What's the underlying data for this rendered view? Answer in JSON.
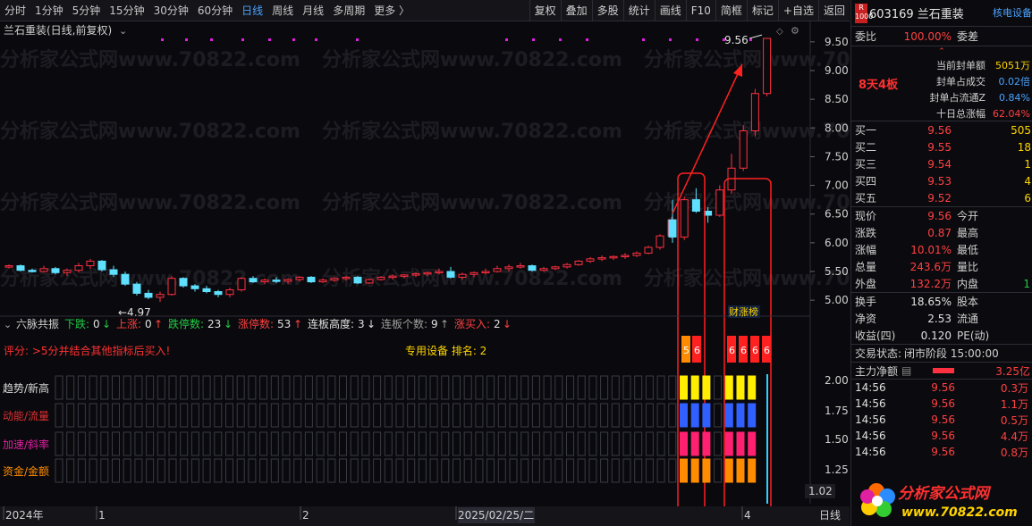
{
  "toolbar": {
    "periods": [
      "分时",
      "1分钟",
      "5分钟",
      "15分钟",
      "30分钟",
      "60分钟",
      "日线",
      "周线",
      "月线",
      "多周期",
      "更多 〉"
    ],
    "active": "日线",
    "buttons": [
      "复权",
      "叠加",
      "多股",
      "统计",
      "画线",
      "F10",
      "简框",
      "标记",
      "+自选",
      "返回"
    ]
  },
  "chart": {
    "title": "兰石重装(日线,前复权)",
    "price_ticks": [
      "9.50",
      "9.00",
      "8.50",
      "8.00",
      "7.50",
      "7.00",
      "6.50",
      "6.00",
      "5.50",
      "5.00"
    ],
    "high_label": "9.56",
    "low_label": "←4.97",
    "watermark": "分析家公式网www.70822.com"
  },
  "indicator": {
    "name": "六脉共振",
    "stats": [
      {
        "label": "下跌:",
        "value": "0",
        "color": "#22cc44"
      },
      {
        "label": "上涨:",
        "value": "0",
        "color": "#ff4040"
      },
      {
        "label": "跌停数:",
        "value": "23",
        "color": "#22cc44"
      },
      {
        "label": "涨停数:",
        "value": "53",
        "color": "#ff4040"
      },
      {
        "label": "连板高度:",
        "value": "3",
        "color": "#e0e0e0"
      },
      {
        "label": "连板个数:",
        "value": "9",
        "color": "#a0a0a0"
      },
      {
        "label": "涨买入:",
        "value": "2",
        "color": "#ff4040"
      }
    ],
    "score_text": "评分: >5分并结合其他指标后买入!",
    "special_text": "专用设备 排名: 2",
    "rows": [
      "趋势/新高",
      "动能/流量",
      "加速/斜率",
      "资金/金额"
    ],
    "ticks": [
      "2.00",
      "1.75",
      "1.50",
      "1.25"
    ],
    "current_value": "1.02",
    "badge": "财涨榜",
    "markers": [
      "5",
      "6",
      "6",
      "6",
      "6",
      "6"
    ]
  },
  "timeline": {
    "labels": [
      "2024年",
      "1",
      "2",
      "2025/02/25/二",
      "4"
    ],
    "period": "日线"
  },
  "panel": {
    "badge": "R",
    "badge_sub": "1000",
    "code": "603169 兰石重装",
    "tag": "核电设备",
    "weibi_label": "委比",
    "weibi_value": "100.00%",
    "weicha_label": "委差",
    "limit_tag": "8天4板",
    "stats": [
      {
        "label": "当前封单额",
        "value": "5051万"
      },
      {
        "label": "封单占成交",
        "value": "0.02倍"
      },
      {
        "label": "封单占流通Z",
        "value": "0.84%"
      },
      {
        "label": "十日总涨幅",
        "value": "62.04%"
      }
    ],
    "bids": [
      {
        "label": "买一",
        "price": "9.56",
        "vol": "505"
      },
      {
        "label": "买二",
        "price": "9.55",
        "vol": "18"
      },
      {
        "label": "买三",
        "price": "9.54",
        "vol": "1"
      },
      {
        "label": "买四",
        "price": "9.53",
        "vol": "4"
      },
      {
        "label": "买五",
        "price": "9.52",
        "vol": "6"
      }
    ],
    "quote": [
      {
        "l1": "现价",
        "v1": "9.56",
        "l2": "今开",
        "v2": ""
      },
      {
        "l1": "涨跌",
        "v1": "0.87",
        "l2": "最高",
        "v2": ""
      },
      {
        "l1": "涨幅",
        "v1": "10.01%",
        "l2": "最低",
        "v2": ""
      },
      {
        "l1": "总量",
        "v1": "243.6万",
        "l2": "量比",
        "v2": ""
      },
      {
        "l1": "外盘",
        "v1": "132.2万",
        "l2": "内盘",
        "v2": "1"
      }
    ],
    "info": [
      {
        "l": "换手",
        "v": "18.65%",
        "l2": "股本"
      },
      {
        "l": "净资",
        "v": "2.53",
        "l2": "流通"
      },
      {
        "l": "收益(四)",
        "v": "0.120",
        "l2": "PE(动)"
      }
    ],
    "status_label": "交易状态:",
    "status_value": "闭市阶段 15:00:00",
    "fund_label": "主力净额",
    "fund_value": "3.25亿",
    "ticks": [
      {
        "t": "14:56",
        "p": "9.56",
        "v": "0.3万"
      },
      {
        "t": "14:56",
        "p": "9.56",
        "v": "1.1万"
      },
      {
        "t": "14:56",
        "p": "9.56",
        "v": "0.5万"
      },
      {
        "t": "14:56",
        "p": "9.56",
        "v": "4.4万"
      },
      {
        "t": "14:56",
        "p": "9.56",
        "v": "0.8万"
      }
    ]
  },
  "logo": {
    "title": "分析家公式网",
    "url": "www.70822.com"
  },
  "chart_data": {
    "type": "candlestick",
    "title": "兰石重装(日线,前复权)",
    "ylim": [
      4.8,
      9.7
    ],
    "y_ticks": [
      5.0,
      5.5,
      6.0,
      6.5,
      7.0,
      7.5,
      8.0,
      8.5,
      9.0,
      9.5
    ],
    "candles": [
      [
        5.58,
        5.62,
        5.55,
        5.6
      ],
      [
        5.6,
        5.62,
        5.5,
        5.52
      ],
      [
        5.52,
        5.55,
        5.48,
        5.5
      ],
      [
        5.5,
        5.6,
        5.48,
        5.55
      ],
      [
        5.55,
        5.58,
        5.45,
        5.48
      ],
      [
        5.48,
        5.55,
        5.42,
        5.52
      ],
      [
        5.52,
        5.65,
        5.48,
        5.6
      ],
      [
        5.6,
        5.72,
        5.55,
        5.68
      ],
      [
        5.68,
        5.7,
        5.5,
        5.53
      ],
      [
        5.53,
        5.6,
        5.4,
        5.45
      ],
      [
        5.45,
        5.5,
        5.25,
        5.28
      ],
      [
        5.28,
        5.32,
        5.08,
        5.12
      ],
      [
        5.12,
        5.18,
        5.02,
        5.05
      ],
      [
        5.05,
        5.15,
        4.97,
        5.1
      ],
      [
        5.1,
        5.42,
        5.08,
        5.38
      ],
      [
        5.38,
        5.4,
        5.22,
        5.25
      ],
      [
        5.25,
        5.28,
        5.15,
        5.2
      ],
      [
        5.2,
        5.25,
        5.12,
        5.15
      ],
      [
        5.15,
        5.18,
        5.05,
        5.1
      ],
      [
        5.1,
        5.22,
        5.05,
        5.18
      ],
      [
        5.18,
        5.4,
        5.15,
        5.38
      ],
      [
        5.38,
        5.42,
        5.3,
        5.32
      ],
      [
        5.32,
        5.38,
        5.28,
        5.35
      ],
      [
        5.35,
        5.4,
        5.3,
        5.33
      ],
      [
        5.33,
        5.38,
        5.28,
        5.36
      ],
      [
        5.36,
        5.42,
        5.32,
        5.4
      ],
      [
        5.4,
        5.42,
        5.3,
        5.32
      ],
      [
        5.32,
        5.38,
        5.3,
        5.35
      ],
      [
        5.35,
        5.4,
        5.32,
        5.38
      ],
      [
        5.38,
        5.42,
        5.34,
        5.4
      ],
      [
        5.4,
        5.42,
        5.28,
        5.3
      ],
      [
        5.3,
        5.38,
        5.28,
        5.36
      ],
      [
        5.36,
        5.42,
        5.34,
        5.4
      ],
      [
        5.4,
        5.45,
        5.36,
        5.42
      ],
      [
        5.42,
        5.45,
        5.38,
        5.44
      ],
      [
        5.44,
        5.48,
        5.4,
        5.46
      ],
      [
        5.46,
        5.5,
        5.42,
        5.48
      ],
      [
        5.48,
        5.55,
        5.45,
        5.5
      ],
      [
        5.5,
        5.58,
        5.38,
        5.4
      ],
      [
        5.4,
        5.48,
        5.36,
        5.45
      ],
      [
        5.45,
        5.5,
        5.4,
        5.48
      ],
      [
        5.48,
        5.55,
        5.45,
        5.5
      ],
      [
        5.5,
        5.6,
        5.48,
        5.55
      ],
      [
        5.55,
        5.62,
        5.5,
        5.58
      ],
      [
        5.58,
        5.65,
        5.55,
        5.6
      ],
      [
        5.6,
        5.62,
        5.5,
        5.52
      ],
      [
        5.52,
        5.58,
        5.5,
        5.55
      ],
      [
        5.55,
        5.6,
        5.52,
        5.58
      ],
      [
        5.58,
        5.65,
        5.55,
        5.62
      ],
      [
        5.62,
        5.7,
        5.6,
        5.68
      ],
      [
        5.68,
        5.75,
        5.65,
        5.72
      ],
      [
        5.72,
        5.78,
        5.68,
        5.74
      ],
      [
        5.74,
        5.78,
        5.7,
        5.76
      ],
      [
        5.76,
        5.82,
        5.72,
        5.78
      ],
      [
        5.78,
        5.85,
        5.75,
        5.82
      ],
      [
        5.82,
        5.95,
        5.8,
        5.92
      ],
      [
        5.92,
        6.15,
        5.88,
        6.12
      ],
      [
        6.12,
        6.45,
        6.08,
        6.4
      ],
      [
        6.4,
        6.75,
        6.0,
        6.1
      ],
      [
        6.1,
        6.8,
        6.05,
        6.75
      ],
      [
        6.75,
        6.95,
        6.52,
        6.55
      ],
      [
        6.55,
        6.62,
        6.35,
        6.48
      ],
      [
        6.48,
        7.0,
        6.45,
        6.92
      ],
      [
        6.92,
        7.55,
        6.85,
        7.3
      ],
      [
        7.3,
        8.05,
        7.25,
        7.95
      ],
      [
        7.95,
        8.68,
        7.85,
        8.6
      ],
      [
        8.6,
        9.56,
        8.55,
        9.56
      ]
    ]
  }
}
